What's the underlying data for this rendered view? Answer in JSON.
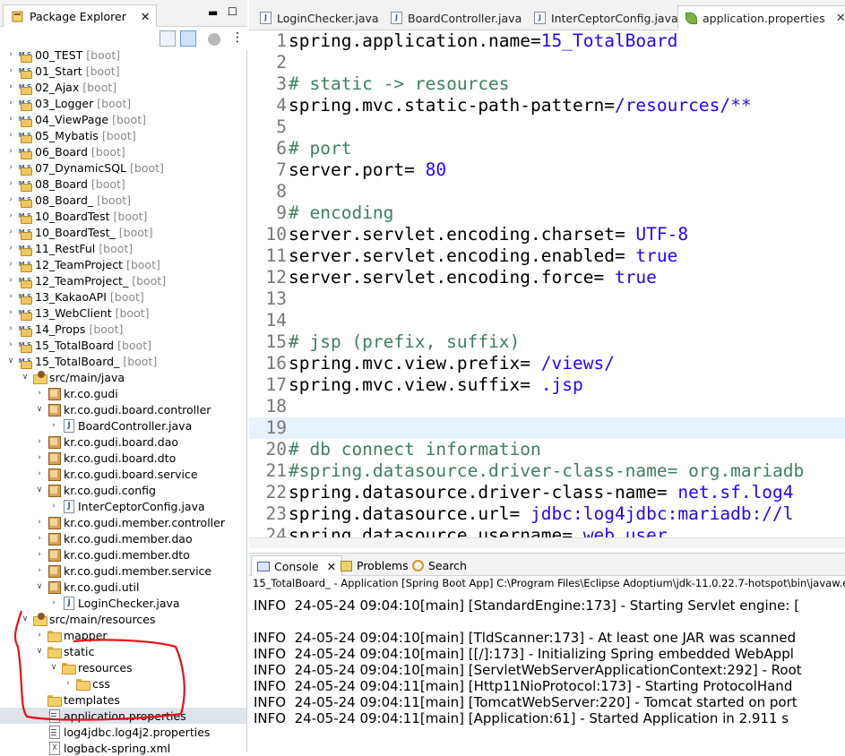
{
  "package_explorer": {
    "title": "Package Explorer",
    "projects": [
      {
        "name": "00_TEST",
        "tag": "[boot]"
      },
      {
        "name": "01_Start",
        "tag": "[boot]"
      },
      {
        "name": "02_Ajax",
        "tag": "[boot]"
      },
      {
        "name": "03_Logger",
        "tag": "[boot]"
      },
      {
        "name": "04_ViewPage",
        "tag": "[boot]"
      },
      {
        "name": "05_Mybatis",
        "tag": "[boot]"
      },
      {
        "name": "06_Board",
        "tag": "[boot]"
      },
      {
        "name": "07_DynamicSQL",
        "tag": "[boot]"
      },
      {
        "name": "08_Board",
        "tag": "[boot]"
      },
      {
        "name": "08_Board_",
        "tag": "[boot]"
      },
      {
        "name": "10_BoardTest",
        "tag": "[boot]"
      },
      {
        "name": "10_BoardTest_",
        "tag": "[boot]"
      },
      {
        "name": "11_RestFul",
        "tag": "[boot]"
      },
      {
        "name": "12_TeamProject",
        "tag": "[boot]"
      },
      {
        "name": "12_TeamProject_",
        "tag": "[boot]"
      },
      {
        "name": "13_KakaoAPI",
        "tag": "[boot]"
      },
      {
        "name": "13_WebClient",
        "tag": "[boot]"
      },
      {
        "name": "14_Props",
        "tag": "[boot]"
      },
      {
        "name": "15_TotalBoard",
        "tag": "[boot]"
      },
      {
        "name": "15_TotalBoard_",
        "tag": "[boot]"
      }
    ],
    "open_project_children": [
      "src/main/java",
      "kr.co.gudi",
      "kr.co.gudi.board.controller",
      "BoardController.java",
      "kr.co.gudi.board.dao",
      "kr.co.gudi.board.dto",
      "kr.co.gudi.board.service",
      "kr.co.gudi.config",
      "InterCeptorConfig.java",
      "kr.co.gudi.member.controller",
      "kr.co.gudi.member.dao",
      "kr.co.gudi.member.dto",
      "kr.co.gudi.member.service",
      "kr.co.gudi.util",
      "LoginChecker.java",
      "src/main/resources",
      "mapper",
      "static",
      "resources",
      "css",
      "templates",
      "application.properties",
      "log4jdbc.log4j2.properties",
      "logback-spring.xml"
    ]
  },
  "editor": {
    "tabs": [
      "LoginChecker.java",
      "BoardController.java",
      "InterCeptorConfig.java",
      "application.properties"
    ],
    "active_tab": "application.properties",
    "line_numbers": [
      "1",
      "2",
      "3",
      "4",
      "5",
      "6",
      "7",
      "8",
      "9",
      "10",
      "11",
      "12",
      "13",
      "14",
      "15",
      "16",
      "17",
      "18",
      "19",
      "20",
      "21",
      "22",
      "23",
      "24"
    ],
    "lines": [
      {
        "k": "spring.application.name=",
        "v": "15_TotalBoard",
        "c": ""
      },
      {
        "k": "",
        "v": "",
        "c": ""
      },
      {
        "k": "",
        "v": "",
        "c": "# static -> resources"
      },
      {
        "k": "spring.mvc.static-path-pattern=",
        "v": "/resources/**",
        "c": ""
      },
      {
        "k": "",
        "v": "",
        "c": ""
      },
      {
        "k": "",
        "v": "",
        "c": "# port"
      },
      {
        "k": "server.port= ",
        "v": "80",
        "c": ""
      },
      {
        "k": "",
        "v": "",
        "c": ""
      },
      {
        "k": "",
        "v": "",
        "c": "# encoding"
      },
      {
        "k": "server.servlet.encoding.charset= ",
        "v": "UTF-8",
        "c": ""
      },
      {
        "k": "server.servlet.encoding.enabled= ",
        "v": "true",
        "c": ""
      },
      {
        "k": "server.servlet.encoding.force= ",
        "v": "true",
        "c": ""
      },
      {
        "k": "",
        "v": "",
        "c": ""
      },
      {
        "k": "",
        "v": "",
        "c": ""
      },
      {
        "k": "",
        "v": "",
        "c": "# jsp (prefix, suffix)"
      },
      {
        "k": "spring.mvc.view.prefix= ",
        "v": "/views/",
        "c": ""
      },
      {
        "k": "spring.mvc.view.suffix= ",
        "v": ".jsp",
        "c": ""
      },
      {
        "k": "",
        "v": "",
        "c": ""
      },
      {
        "k": "",
        "v": "",
        "c": ""
      },
      {
        "k": "",
        "v": "",
        "c": "# db connect information"
      },
      {
        "k": "",
        "v": "",
        "c": "#spring.datasource.driver-class-name= org.mariadb"
      },
      {
        "k": "spring.datasource.driver-class-name= ",
        "v": "net.sf.log4",
        "c": ""
      },
      {
        "k": "spring.datasource.url= ",
        "v": "jdbc:log4jdbc:mariadb://l",
        "c": ""
      },
      {
        "k": "spring.datasource.username= ",
        "v": "web_user",
        "c": ""
      }
    ]
  },
  "console": {
    "tabs": [
      "Console",
      "Problems",
      "Search"
    ],
    "launch_path": "15_TotalBoard_ - Application [Spring Boot App] C:\\Program Files\\Eclipse Adoptium\\jdk-11.0.22.7-hotspot\\bin\\javaw.exe",
    "lines": [
      "INFO  24-05-24 09:04:10[main] [StandardEngine:173] - Starting Servlet engine: [",
      "",
      "INFO  24-05-24 09:04:10[main] [TldScanner:173] - At least one JAR was scanned",
      "INFO  24-05-24 09:04:10[main] [[/]:173] - Initializing Spring embedded WebAppl",
      "INFO  24-05-24 09:04:10[main] [ServletWebServerApplicationContext:292] - Root",
      "INFO  24-05-24 09:04:11[main] [Http11NioProtocol:173] - Starting ProtocolHand",
      "INFO  24-05-24 09:04:11[main] [TomcatWebServer:220] - Tomcat started on port",
      "INFO  24-05-24 09:04:11[main] [Application:61] - Started Application in 2.911 s"
    ]
  }
}
